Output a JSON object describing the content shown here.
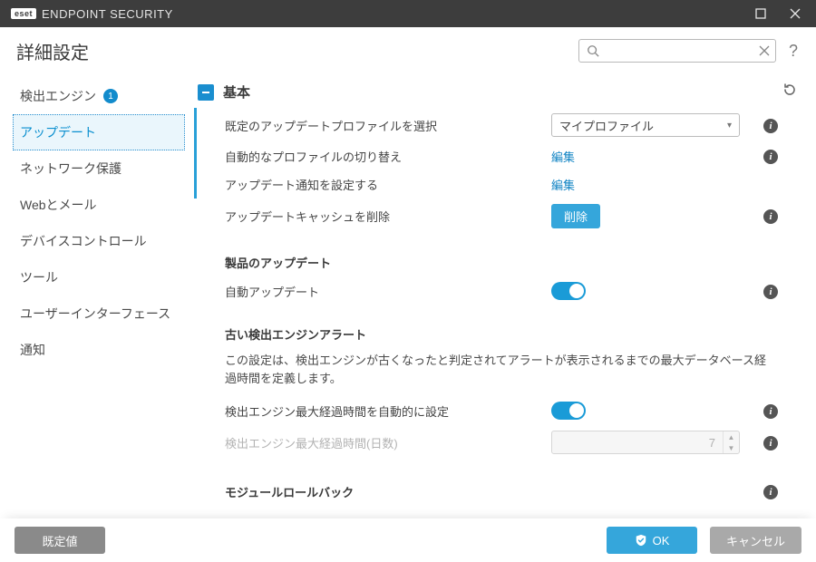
{
  "titlebar": {
    "brand_pill": "eset",
    "brand_text": "ENDPOINT SECURITY"
  },
  "header": {
    "title": "詳細設定",
    "search_placeholder": ""
  },
  "sidebar": {
    "items": [
      {
        "label": "検出エンジン",
        "badge": "1"
      },
      {
        "label": "アップデート"
      },
      {
        "label": "ネットワーク保護"
      },
      {
        "label": "Webとメール"
      },
      {
        "label": "デバイスコントロール"
      },
      {
        "label": "ツール"
      },
      {
        "label": "ユーザーインターフェース"
      },
      {
        "label": "通知"
      }
    ]
  },
  "main": {
    "section_title": "基本",
    "rows": {
      "default_profile": {
        "label": "既定のアップデートプロファイルを選択",
        "value": "マイプロファイル"
      },
      "auto_switch": {
        "label": "自動的なプロファイルの切り替え",
        "action": "編集"
      },
      "notify": {
        "label": "アップデート通知を設定する",
        "action": "編集"
      },
      "clear_cache": {
        "label": "アップデートキャッシュを削除",
        "button": "削除"
      }
    },
    "product_update": {
      "heading": "製品のアップデート",
      "auto_update": {
        "label": "自動アップデート"
      }
    },
    "old_engine": {
      "heading": "古い検出エンジンアラート",
      "desc": "この設定は、検出エンジンが古くなったと判定されてアラートが表示されるまでの最大データベース経過時間を定義します。",
      "auto_max": {
        "label": "検出エンジン最大経過時間を自動的に設定"
      },
      "days": {
        "label": "検出エンジン最大経過時間(日数)",
        "value": "7"
      }
    },
    "rollback": {
      "heading": "モジュールロールバック"
    }
  },
  "footer": {
    "defaults": "既定値",
    "ok": "OK",
    "cancel": "キャンセル"
  }
}
